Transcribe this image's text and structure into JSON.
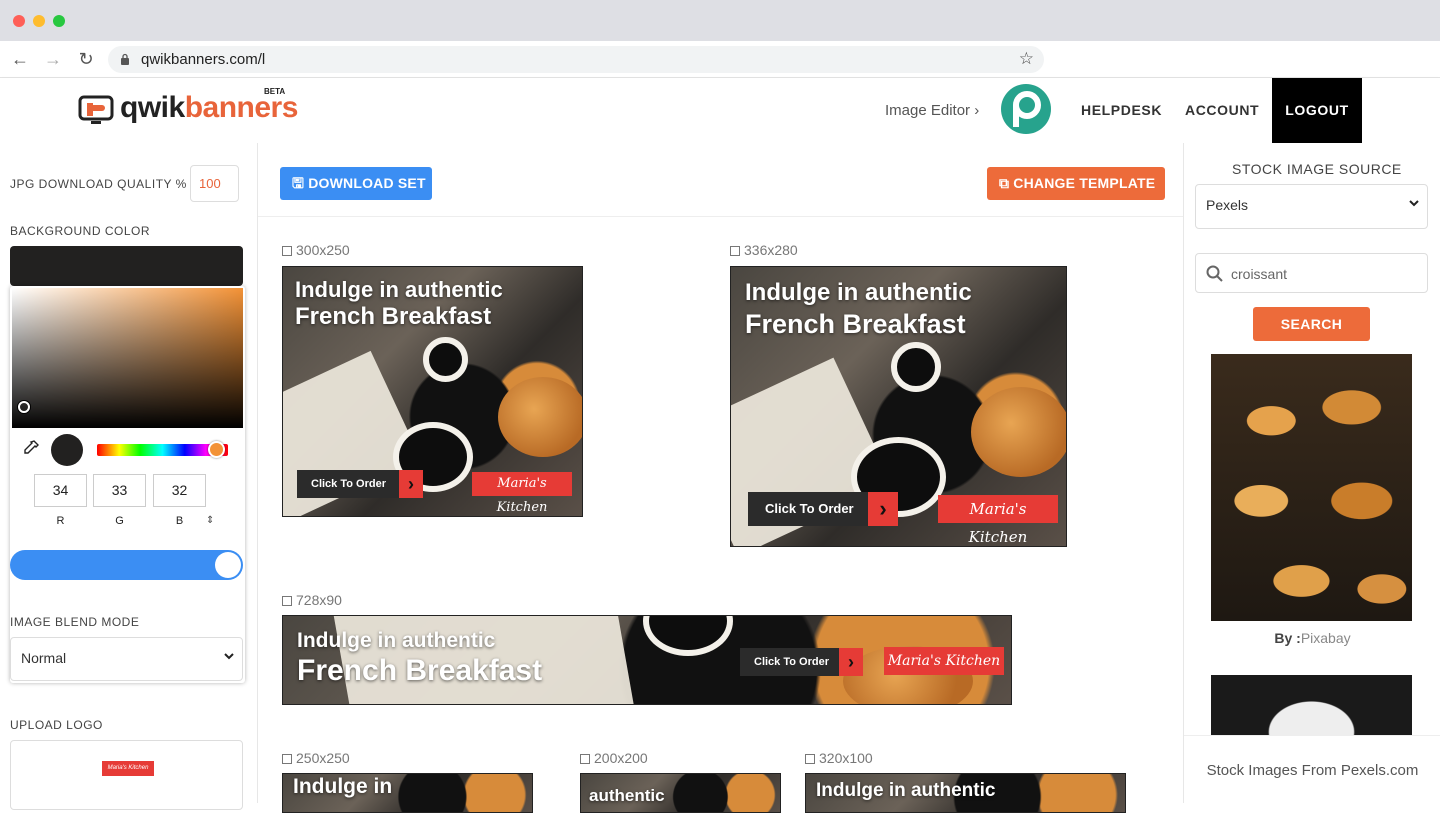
{
  "browser": {
    "url": "qwikbanners.com/l"
  },
  "header": {
    "logo_text_a": "qwik",
    "logo_text_b": "banners",
    "logo_beta": "BETA",
    "image_editor": "Image Editor ›",
    "nav": [
      "HELPDESK",
      "ACCOUNT",
      "LOGOUT"
    ]
  },
  "left_panel": {
    "quality_label": "JPG DOWNLOAD QUALITY %",
    "quality_value": "100",
    "bg_color_label": "BACKGROUND COLOR",
    "bg_color": "#222120",
    "rgb": {
      "r": "34",
      "g": "33",
      "b": "32"
    },
    "rgb_labels": {
      "r": "R",
      "g": "G",
      "b": "B",
      "spin": "⇕"
    },
    "blend_label": "IMAGE BLEND MODE",
    "blend_value": "Normal",
    "upload_label": "UPLOAD LOGO",
    "upload_logo_text": "Maria's Kitchen"
  },
  "toolbar": {
    "download_label": "DOWNLOAD SET",
    "change_template_label": "CHANGE TEMPLATE"
  },
  "banners": [
    {
      "size": "300x250",
      "line1": "Indulge in authentic",
      "line2": "French Breakfast",
      "cta": "Click To Order",
      "brand": "Maria's Kitchen"
    },
    {
      "size": "336x280",
      "line1": "Indulge in authentic",
      "line2": "French Breakfast",
      "cta": "Click To Order",
      "brand": "Maria's Kitchen"
    },
    {
      "size": "728x90",
      "line1": "Indulge in authentic",
      "line2": "French Breakfast",
      "cta": "Click To Order",
      "brand": "Maria's Kitchen"
    },
    {
      "size": "250x250",
      "line1": "Indulge in"
    },
    {
      "size": "200x200",
      "line1": "authentic"
    },
    {
      "size": "320x100",
      "line1": "Indulge in authentic"
    }
  ],
  "right_panel": {
    "source_label": "STOCK IMAGE SOURCE",
    "source_value": "Pexels",
    "search_value": "croissant",
    "search_button": "SEARCH",
    "by_label": "By :",
    "by_source": "Pixabay",
    "footer": "Stock Images From Pexels.com"
  },
  "colors": {
    "accent_orange": "#ed6b3a",
    "accent_blue": "#3b8ef3",
    "brand_red": "#e63b36"
  }
}
